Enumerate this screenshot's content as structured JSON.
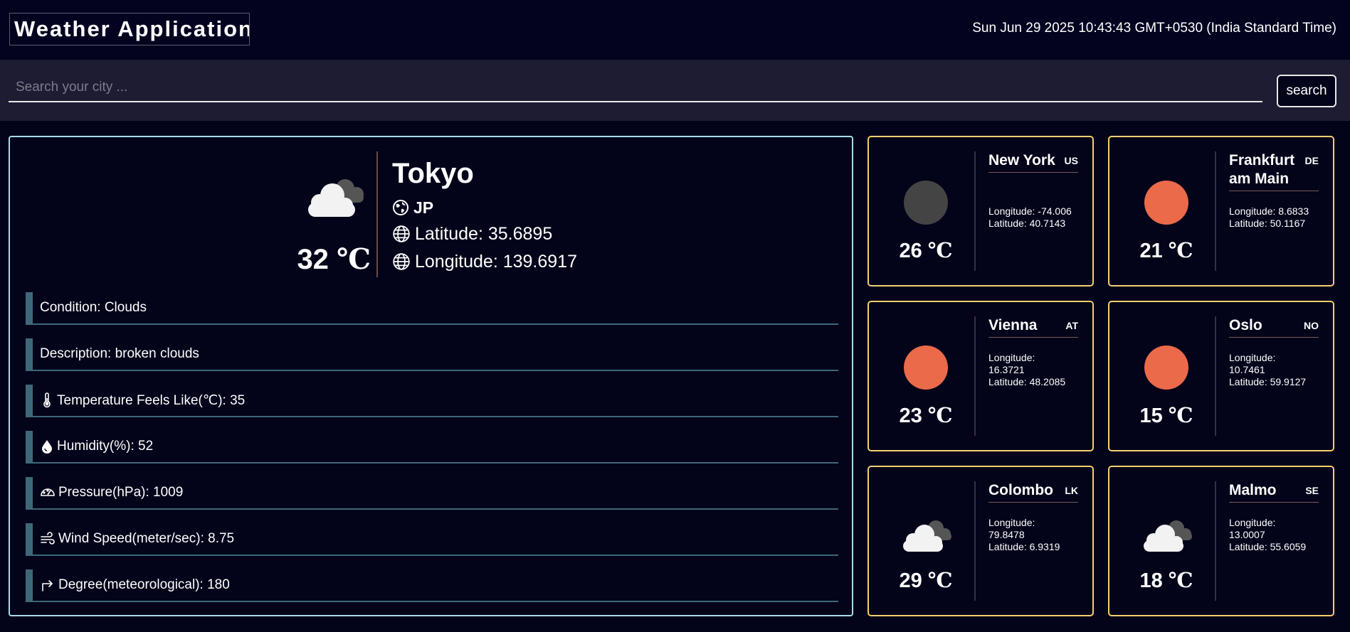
{
  "header": {
    "title": "Weather Application",
    "datetime": "Sun Jun 29 2025 10:43:43 GMT+0530 (India Standard Time)"
  },
  "search": {
    "placeholder": "Search your city ...",
    "value": "",
    "button_label": "search"
  },
  "main": {
    "icon": "cloud-icon",
    "temperature": "32",
    "unit": "℃",
    "city": "Tokyo",
    "country": "JP",
    "latitude_text": "Latitude: 35.6895",
    "longitude_text": "Longitude: 139.6917",
    "details": [
      {
        "icon": "none",
        "text": "Condition: Clouds"
      },
      {
        "icon": "none",
        "text": "Description: broken clouds"
      },
      {
        "icon": "thermometer-icon",
        "text": "Temperature Feels Like(℃): 35"
      },
      {
        "icon": "droplet-icon",
        "text": "Humidity(%): 52"
      },
      {
        "icon": "gauge-icon",
        "text": "Pressure(hPa): 1009"
      },
      {
        "icon": "wind-icon",
        "text": "Wind Speed(meter/sec): 8.75"
      },
      {
        "icon": "turn-right-arrow-icon",
        "text": "Degree(meteorological): 180"
      }
    ]
  },
  "cities": [
    {
      "name": "New York",
      "code": "US",
      "temperature": "26",
      "unit": "℃",
      "icon": "moon-icon",
      "icon_color": "#444444",
      "longitude": "Longitude: -74.006",
      "latitude": "Latitude: 40.7143"
    },
    {
      "name": "Frankfurt am Main",
      "code": "DE",
      "temperature": "21",
      "unit": "℃",
      "icon": "sun-icon",
      "icon_color": "#ea6a4a",
      "longitude": "Longitude: 8.6833",
      "latitude": "Latitude: 50.1167"
    },
    {
      "name": "Vienna",
      "code": "AT",
      "temperature": "23",
      "unit": "℃",
      "icon": "sun-icon",
      "icon_color": "#ea6a4a",
      "longitude": "Longitude: 16.3721",
      "latitude": "Latitude: 48.2085"
    },
    {
      "name": "Oslo",
      "code": "NO",
      "temperature": "15",
      "unit": "℃",
      "icon": "sun-icon",
      "icon_color": "#ea6a4a",
      "longitude": "Longitude: 10.7461",
      "latitude": "Latitude: 59.9127"
    },
    {
      "name": "Colombo",
      "code": "LK",
      "temperature": "29",
      "unit": "℃",
      "icon": "cloud-icon",
      "icon_color": "#f2f2f2",
      "longitude": "Longitude: 79.8478",
      "latitude": "Latitude: 6.9319"
    },
    {
      "name": "Malmo",
      "code": "SE",
      "temperature": "18",
      "unit": "℃",
      "icon": "cloud-icon",
      "icon_color": "#f2f2f2",
      "longitude": "Longitude: 13.0007",
      "latitude": "Latitude: 55.6059"
    }
  ],
  "colors": {
    "background": "#03031a",
    "searchbar": "#1d1c33",
    "main_border": "#a8dcea",
    "card_border": "#f5cf6e",
    "detail_accent": "#3d6878",
    "sun": "#ea6a4a",
    "moon": "#444444"
  }
}
